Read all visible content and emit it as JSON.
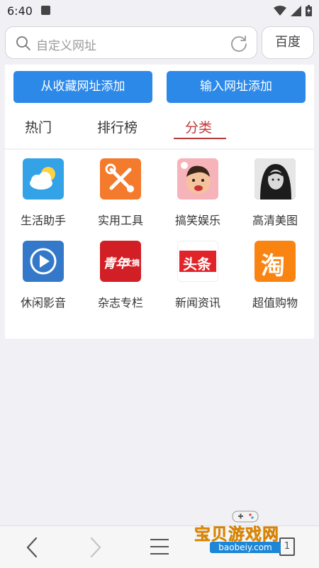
{
  "status_bar": {
    "time": "6:40"
  },
  "search": {
    "placeholder": "自定义网址",
    "engine_label": "百度"
  },
  "actions": {
    "add_from_favorites": "从收藏网址添加",
    "add_by_url": "输入网址添加"
  },
  "tabs": [
    {
      "label": "热门",
      "active": false
    },
    {
      "label": "排行榜",
      "active": false
    },
    {
      "label": "分类",
      "active": true
    }
  ],
  "categories": [
    {
      "label": "生活助手",
      "icon": "weather-cloud-icon",
      "color": "#33a2e6"
    },
    {
      "label": "实用工具",
      "icon": "tools-icon",
      "color": "#f47a2c"
    },
    {
      "label": "搞笑娱乐",
      "icon": "funny-face-icon",
      "color": "#f6b3b9"
    },
    {
      "label": "高清美图",
      "icon": "portrait-photo-icon",
      "color": "#2b2b2b"
    },
    {
      "label": "休闲影音",
      "icon": "play-icon",
      "color": "#3478c9"
    },
    {
      "label": "杂志专栏",
      "icon": "magazine-icon",
      "color": "#d11f25",
      "text": "青年",
      "sub_text": "文摘"
    },
    {
      "label": "新闻资讯",
      "icon": "news-headline-icon",
      "color": "#e1242a",
      "text": "头条"
    },
    {
      "label": "超值购物",
      "icon": "taobao-icon",
      "color": "#f98412",
      "text": "淘"
    }
  ],
  "bottom_nav": {
    "tab_count": "1"
  },
  "watermark": {
    "text": "宝贝游戏网",
    "sub": "baobeiy.com"
  }
}
